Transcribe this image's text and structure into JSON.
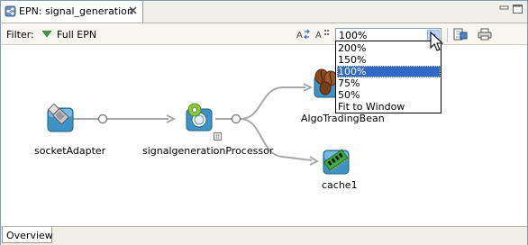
{
  "editor_tab": {
    "title": "EPN: signal_generation",
    "icon": "epn-icon"
  },
  "toolbar": {
    "filter_label": "Filter:",
    "filter_value": "Full EPN",
    "zoom": {
      "value": "100%",
      "options": [
        "200%",
        "150%",
        "100%",
        "75%",
        "50%",
        "Fit to Window"
      ],
      "selected": "100%"
    }
  },
  "nodes": [
    {
      "label": "socketAdapter",
      "icon": "usb-adapter-icon"
    },
    {
      "label": "signalgenerationProcessor",
      "icon": "processor-gear-icon"
    },
    {
      "label": "AlgoTradingBean",
      "icon": "coffee-bean-icon"
    },
    {
      "label": "cache1",
      "icon": "memory-chip-icon"
    }
  ],
  "bottom_tab": {
    "label": "Overview"
  },
  "colors": {
    "selection": "#316ac5",
    "border": "#7f9db9",
    "wire": "#a8a8a8",
    "filter_arrow": "#3c9d3c"
  }
}
